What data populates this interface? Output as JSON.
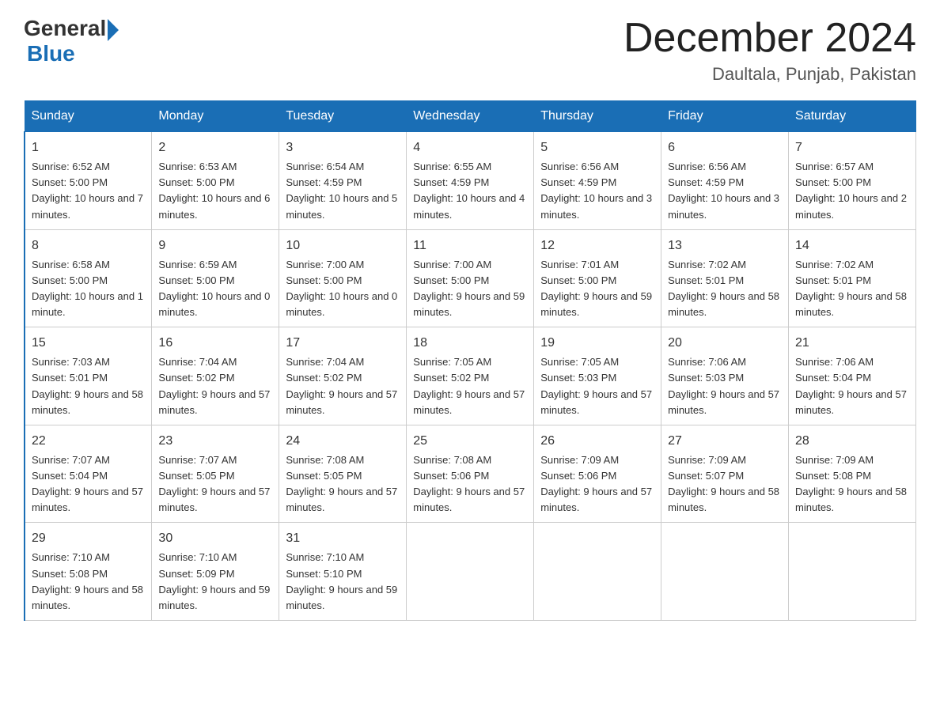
{
  "logo": {
    "general": "General",
    "blue": "Blue"
  },
  "title": "December 2024",
  "location": "Daultala, Punjab, Pakistan",
  "days_of_week": [
    "Sunday",
    "Monday",
    "Tuesday",
    "Wednesday",
    "Thursday",
    "Friday",
    "Saturday"
  ],
  "weeks": [
    [
      {
        "day": "1",
        "sunrise": "6:52 AM",
        "sunset": "5:00 PM",
        "daylight": "10 hours and 7 minutes."
      },
      {
        "day": "2",
        "sunrise": "6:53 AM",
        "sunset": "5:00 PM",
        "daylight": "10 hours and 6 minutes."
      },
      {
        "day": "3",
        "sunrise": "6:54 AM",
        "sunset": "4:59 PM",
        "daylight": "10 hours and 5 minutes."
      },
      {
        "day": "4",
        "sunrise": "6:55 AM",
        "sunset": "4:59 PM",
        "daylight": "10 hours and 4 minutes."
      },
      {
        "day": "5",
        "sunrise": "6:56 AM",
        "sunset": "4:59 PM",
        "daylight": "10 hours and 3 minutes."
      },
      {
        "day": "6",
        "sunrise": "6:56 AM",
        "sunset": "4:59 PM",
        "daylight": "10 hours and 3 minutes."
      },
      {
        "day": "7",
        "sunrise": "6:57 AM",
        "sunset": "5:00 PM",
        "daylight": "10 hours and 2 minutes."
      }
    ],
    [
      {
        "day": "8",
        "sunrise": "6:58 AM",
        "sunset": "5:00 PM",
        "daylight": "10 hours and 1 minute."
      },
      {
        "day": "9",
        "sunrise": "6:59 AM",
        "sunset": "5:00 PM",
        "daylight": "10 hours and 0 minutes."
      },
      {
        "day": "10",
        "sunrise": "7:00 AM",
        "sunset": "5:00 PM",
        "daylight": "10 hours and 0 minutes."
      },
      {
        "day": "11",
        "sunrise": "7:00 AM",
        "sunset": "5:00 PM",
        "daylight": "9 hours and 59 minutes."
      },
      {
        "day": "12",
        "sunrise": "7:01 AM",
        "sunset": "5:00 PM",
        "daylight": "9 hours and 59 minutes."
      },
      {
        "day": "13",
        "sunrise": "7:02 AM",
        "sunset": "5:01 PM",
        "daylight": "9 hours and 58 minutes."
      },
      {
        "day": "14",
        "sunrise": "7:02 AM",
        "sunset": "5:01 PM",
        "daylight": "9 hours and 58 minutes."
      }
    ],
    [
      {
        "day": "15",
        "sunrise": "7:03 AM",
        "sunset": "5:01 PM",
        "daylight": "9 hours and 58 minutes."
      },
      {
        "day": "16",
        "sunrise": "7:04 AM",
        "sunset": "5:02 PM",
        "daylight": "9 hours and 57 minutes."
      },
      {
        "day": "17",
        "sunrise": "7:04 AM",
        "sunset": "5:02 PM",
        "daylight": "9 hours and 57 minutes."
      },
      {
        "day": "18",
        "sunrise": "7:05 AM",
        "sunset": "5:02 PM",
        "daylight": "9 hours and 57 minutes."
      },
      {
        "day": "19",
        "sunrise": "7:05 AM",
        "sunset": "5:03 PM",
        "daylight": "9 hours and 57 minutes."
      },
      {
        "day": "20",
        "sunrise": "7:06 AM",
        "sunset": "5:03 PM",
        "daylight": "9 hours and 57 minutes."
      },
      {
        "day": "21",
        "sunrise": "7:06 AM",
        "sunset": "5:04 PM",
        "daylight": "9 hours and 57 minutes."
      }
    ],
    [
      {
        "day": "22",
        "sunrise": "7:07 AM",
        "sunset": "5:04 PM",
        "daylight": "9 hours and 57 minutes."
      },
      {
        "day": "23",
        "sunrise": "7:07 AM",
        "sunset": "5:05 PM",
        "daylight": "9 hours and 57 minutes."
      },
      {
        "day": "24",
        "sunrise": "7:08 AM",
        "sunset": "5:05 PM",
        "daylight": "9 hours and 57 minutes."
      },
      {
        "day": "25",
        "sunrise": "7:08 AM",
        "sunset": "5:06 PM",
        "daylight": "9 hours and 57 minutes."
      },
      {
        "day": "26",
        "sunrise": "7:09 AM",
        "sunset": "5:06 PM",
        "daylight": "9 hours and 57 minutes."
      },
      {
        "day": "27",
        "sunrise": "7:09 AM",
        "sunset": "5:07 PM",
        "daylight": "9 hours and 58 minutes."
      },
      {
        "day": "28",
        "sunrise": "7:09 AM",
        "sunset": "5:08 PM",
        "daylight": "9 hours and 58 minutes."
      }
    ],
    [
      {
        "day": "29",
        "sunrise": "7:10 AM",
        "sunset": "5:08 PM",
        "daylight": "9 hours and 58 minutes."
      },
      {
        "day": "30",
        "sunrise": "7:10 AM",
        "sunset": "5:09 PM",
        "daylight": "9 hours and 59 minutes."
      },
      {
        "day": "31",
        "sunrise": "7:10 AM",
        "sunset": "5:10 PM",
        "daylight": "9 hours and 59 minutes."
      },
      null,
      null,
      null,
      null
    ]
  ],
  "labels": {
    "sunrise": "Sunrise:",
    "sunset": "Sunset:",
    "daylight": "Daylight:"
  }
}
